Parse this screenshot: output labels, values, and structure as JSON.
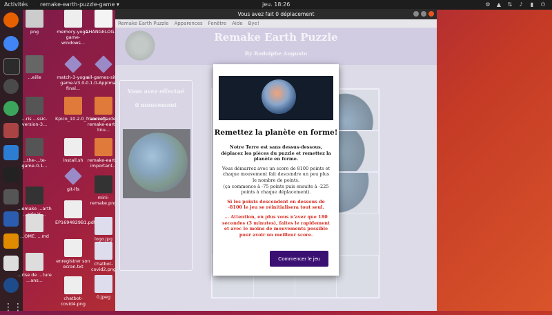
{
  "topbar": {
    "activities": "Activités",
    "app_name": "remake-earth-puzzle-game ▾",
    "clock": "jeu. 18:26"
  },
  "desktop_icons": [
    {
      "label": "png"
    },
    {
      "label": "memory-yoga-game-windows..."
    },
    {
      "label": "CHANGELOG.md"
    },
    {
      "label": "...eille"
    },
    {
      "label": "match-3-yoga-game-V3.0-final..."
    },
    {
      "label": "all-games-site-0.1.0-AppImage"
    },
    {
      "label": "...ris ...ssic-version-3..."
    },
    {
      "label": "Kpico_10.2.0_frencsoft..."
    },
    {
      "label": "sauvegarde-remake-earth-linu..."
    },
    {
      "label": "...the-...te-game-0.1..."
    },
    {
      "label": "install.sh"
    },
    {
      "label": "remake-earth-important..."
    },
    {
      "label": "git-lfs"
    },
    {
      "label": "mini-remake.png"
    },
    {
      "label": "...emake ...arth ...zzle-V-..."
    },
    {
      "label": "EP1694829B1.pdf"
    },
    {
      "label": "logo.jpg"
    },
    {
      "label": "...OME. ...md"
    },
    {
      "label": "enregistrer son ecran.txt"
    },
    {
      "label": "chatbot-covid2.png"
    },
    {
      "label": "...rise de ...ture ...ans..."
    },
    {
      "label": "chatbot-covid4.png"
    },
    {
      "label": "0.jpeg"
    }
  ],
  "window": {
    "title": "Vous avez fait 0 déplacement",
    "menu": [
      "Remake Earth Puzzle",
      "Apparences",
      "Fenêtre",
      "Aide",
      "Bye!"
    ],
    "app_title": "Remake Earth Puzzle",
    "author": "By Rodolphe Augusto",
    "side": {
      "done_label": "Vous avez effectué",
      "moves_label": "0 mouvement"
    }
  },
  "modal": {
    "title": "Remettez la planète en forme!",
    "intro": "Notre Terre est sans dessus-dessous, déplacez les pièces du puzzle et remettez la planète en forme.",
    "rules": "Vous démarrez avec un score de 8100 points et chaque mouvement fait descendre un peu plus le nombre de points.",
    "rules_detail": "(ça commence à -75 points puis ensuite à -225 points à chaque déplacement).",
    "warning": "Si les points descendent en dessous de -8100 le jeu se réinitialisera tout seul.",
    "attention": "... Attention, en plus vous n'avez que 180 secondes (3 minutes), faites le rapidement et avec le moins de mouvements possible pour avoir un meilleur score.",
    "start_button": "Commencer le jeu"
  },
  "colors": {
    "accent": "#3b1073",
    "warning": "#d62b1f",
    "ubuntu_orange": "#e95420"
  }
}
